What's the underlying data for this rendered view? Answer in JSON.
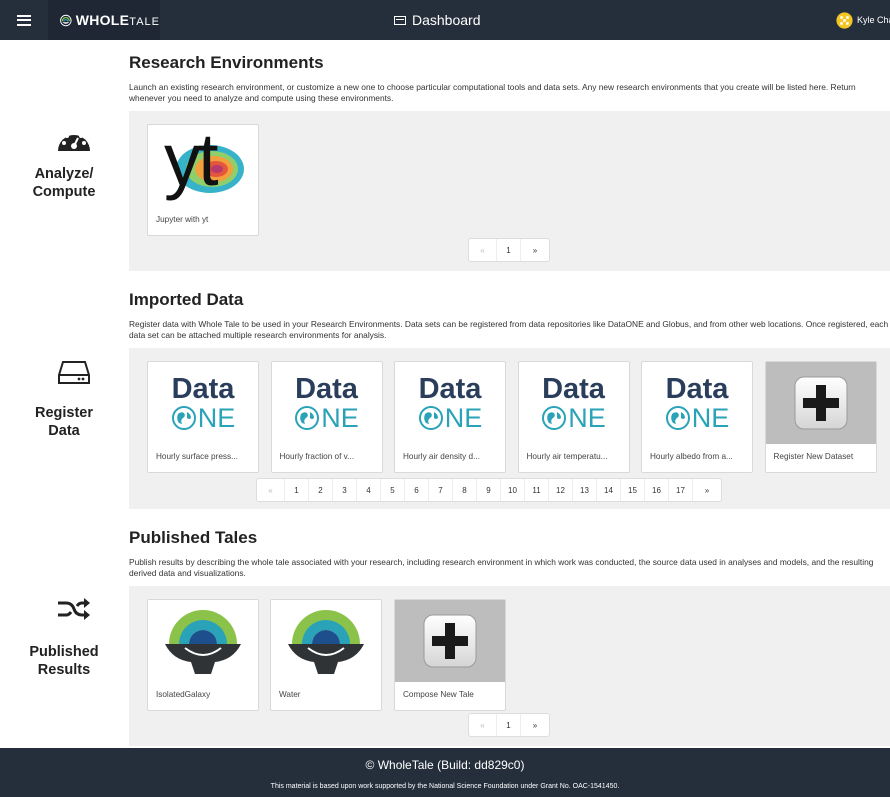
{
  "header": {
    "logo_bold": "WHOLE",
    "logo_light": "TALE",
    "title": "Dashboard",
    "user_name": "Kyle Char"
  },
  "side": {
    "analyze_line1": "Analyze/",
    "analyze_line2": "Compute",
    "register_line1": "Register",
    "register_line2": "Data",
    "published_line1": "Published",
    "published_line2": "Results"
  },
  "research": {
    "title": "Research Environments",
    "description": "Launch an existing research environment, or customize a new one to choose particular computational tools and data sets. Any new research environments that you create will be listed here. Return whenever you need to analyze and compute using these environments.",
    "cards": [
      {
        "label": "Jupyter with yt",
        "logo_text": "yt"
      }
    ],
    "pager": [
      "«",
      "1",
      "»"
    ]
  },
  "imported": {
    "title": "Imported Data",
    "description": "Register data with Whole Tale to be used in your Research Environments. Data sets can be registered from data repositories like DataONE and Globus, and from other web locations. Once registered, each data set can be attached multiple research environments for analysis.",
    "logo_top": "Data",
    "logo_bottom": "NE",
    "cards": [
      {
        "label": "Hourly surface press..."
      },
      {
        "label": "Hourly fraction of v..."
      },
      {
        "label": "Hourly air density d..."
      },
      {
        "label": "Hourly air temperatu..."
      },
      {
        "label": "Hourly albedo from a..."
      },
      {
        "label": "Register New Dataset"
      }
    ],
    "pager": [
      "«",
      "1",
      "2",
      "3",
      "4",
      "5",
      "6",
      "7",
      "8",
      "9",
      "10",
      "11",
      "12",
      "13",
      "14",
      "15",
      "16",
      "17",
      "»"
    ]
  },
  "published": {
    "title": "Published Tales",
    "description": "Publish results by describing the whole tale associated with your research, including research environment in which work was conducted, the source data used in analyses and models, and the resulting derived data and visualizations.",
    "cards": [
      {
        "label": "IsolatedGalaxy"
      },
      {
        "label": "Water"
      },
      {
        "label": "Compose New Tale"
      }
    ],
    "pager": [
      "«",
      "1",
      "»"
    ]
  },
  "footer": {
    "line1": "© WholeTale (Build: dd829c0)",
    "line2": "This material is based upon work supported by the National Science Foundation under Grant No. OAC-1541450."
  },
  "colors": {
    "navbar": "#252f3c",
    "panel": "#f0f0f0",
    "data_navy": "#2a3e5c",
    "one_teal": "#2aa2b8"
  }
}
